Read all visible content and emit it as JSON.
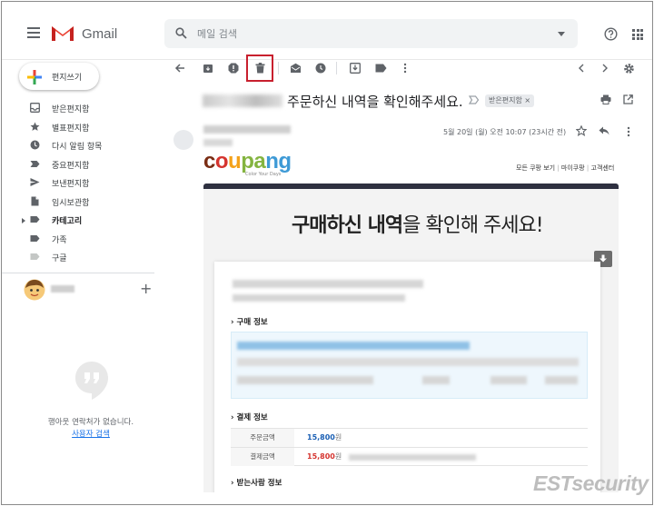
{
  "app": {
    "logo_text": "Gmail"
  },
  "search": {
    "placeholder": "메일 검색"
  },
  "sidebar": {
    "compose_label": "편지쓰기",
    "items": [
      {
        "label": "받은편지함",
        "icon": "inbox-icon",
        "bold": false
      },
      {
        "label": "별표편지함",
        "icon": "star-icon",
        "bold": false
      },
      {
        "label": "다시 알림 항목",
        "icon": "clock-icon",
        "bold": false
      },
      {
        "label": "중요편지함",
        "icon": "important-icon",
        "bold": false
      },
      {
        "label": "보낸편지함",
        "icon": "send-icon",
        "bold": false
      },
      {
        "label": "임시보관함",
        "icon": "draft-icon",
        "bold": false
      },
      {
        "label": "카테고리",
        "icon": "label-icon",
        "bold": true
      },
      {
        "label": "가족",
        "icon": "label-icon",
        "bold": false
      },
      {
        "label": "구글",
        "icon": "label-icon",
        "bold": false
      }
    ],
    "hangouts_empty": "행아웃 연락처가 없습니다.",
    "hangouts_search": "사용자 검색"
  },
  "email": {
    "subject": "주문하신 내역을 확인해주세요.",
    "label_chip": "받은편지함 ×",
    "date": "5월 20일 (월) 오전 10:07 (23시간 전)"
  },
  "body": {
    "brand": {
      "c": "c",
      "o": "o",
      "u": "u",
      "pa": "pa",
      "ng": "ng"
    },
    "tagline": "Color Your Days",
    "top_links": [
      "모든 쿠팡 보기",
      "마이쿠팡",
      "고객센터"
    ],
    "headline_bold": "구매하신 내역",
    "headline_rest": "을 확인해 주세요!",
    "section_purchase": "구매 정보",
    "section_payment": "결제 정보",
    "section_recipient": "받는사람 정보",
    "payment_rows": [
      {
        "key": "주문금액",
        "value": "15,800",
        "unit": "원",
        "color": "#1a5fb4"
      },
      {
        "key": "결제금액",
        "value": "15,800",
        "unit": "원",
        "color": "#d5342f"
      }
    ]
  },
  "watermark": "ESTsecurity",
  "colors": {
    "highlight_border": "#c8202e",
    "gmail_red": "#ea4335"
  }
}
